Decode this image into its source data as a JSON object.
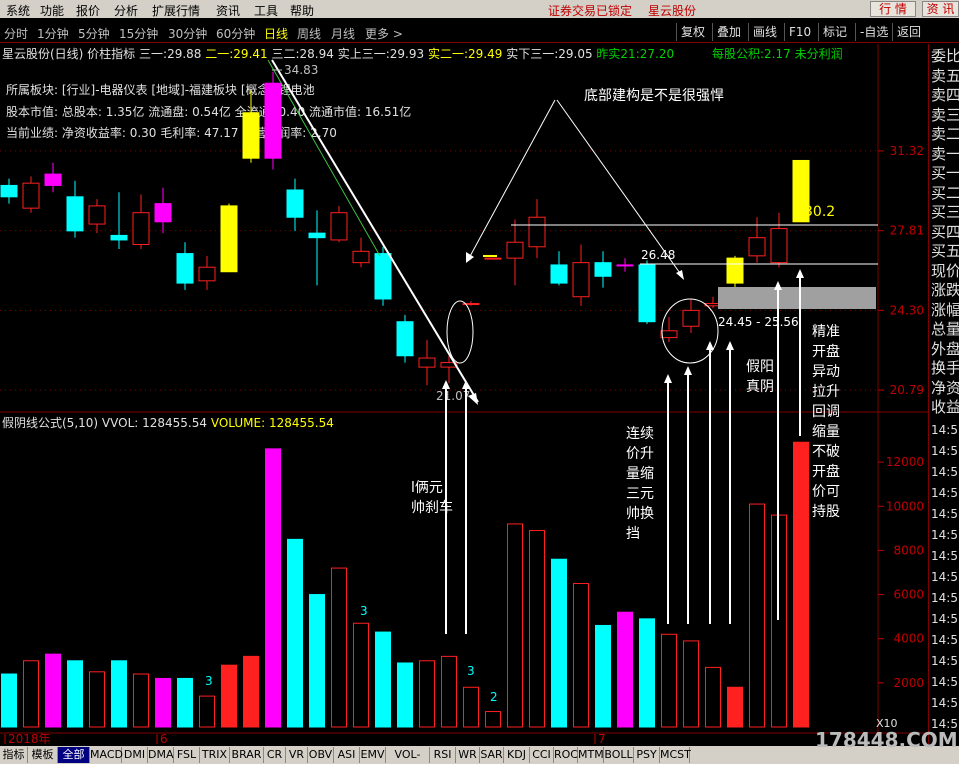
{
  "menu": {
    "items": [
      "系统",
      "功能",
      "报价",
      "分析",
      "扩展行情",
      "资讯",
      "工具",
      "帮助"
    ],
    "lock_status": "证券交易已锁定",
    "stock_name": "星云股份",
    "quote_btn": "行 情",
    "info_btn": "资 讯"
  },
  "periods": {
    "items": [
      "分时",
      "1分钟",
      "5分钟",
      "15分钟",
      "30分钟",
      "60分钟",
      "日线",
      "周线",
      "月线",
      "更多 >"
    ],
    "active_index": 6,
    "tools": [
      "复权",
      "叠加",
      "画线",
      "F10",
      "标记",
      "-自选",
      "返回"
    ]
  },
  "header": {
    "title": "星云股份(日线) 价柱指标",
    "p1_label": "三一:",
    "p1_val": "29.88",
    "p2_label": "二一:",
    "p2_val": "29.41",
    "p3_label": "三二:",
    "p3_val": "28.94",
    "p4_label": "实上三一:",
    "p4_val": "29.93",
    "p5_label": "实二一:",
    "p5_val": "29.49",
    "p6_label": "实下三一:",
    "p6_val": "29.05",
    "p7_label": "昨实21:",
    "p7_val": "27.20",
    "eps_label": "每股公积:",
    "eps_val": "2.17",
    "undist_label": "未分利润"
  },
  "info": {
    "sector": "所属板块: [行业]-电器仪表 [地域]-福建板块 [概念]-锂电池",
    "market_cap": "股本市值: 总股本: 1.35亿 流通盘: 0.54亿 全流通: 0.40 流通市值: 16.51亿",
    "performance": "当前业绩: 净资收益率: 0.30 毛利率: 47.17 主营利润率: 2.70"
  },
  "price_axis": [
    "31.32",
    "27.81",
    "24.30",
    "20.79"
  ],
  "volume_axis": [
    "12000",
    "10000",
    "8000",
    "6000",
    "4000",
    "2000"
  ],
  "volume_header": {
    "formula": "假阴线公式(5,10)",
    "vvol": "VVOL: 128455.54",
    "volume": "VOLUME: 128455.54"
  },
  "x_labels": [
    "2018年",
    "6",
    "7"
  ],
  "volume_scale": "X10",
  "price_labels": {
    "high": "34.83",
    "low": "21.07",
    "mid": "26.48",
    "range": "24.45 - 25.56",
    "target": "30.2"
  },
  "chart_data": {
    "type": "candlestick",
    "ylim": [
      20.0,
      35.5
    ],
    "vol_ylim": [
      0,
      13500
    ],
    "candles": [
      {
        "o": 29.3,
        "c": 29.8,
        "h": 30.1,
        "l": 29.0,
        "v": 2400,
        "color": "cyan"
      },
      {
        "o": 28.8,
        "c": 29.9,
        "h": 30.2,
        "l": 28.6,
        "v": 3000,
        "color": "red"
      },
      {
        "o": 30.3,
        "c": 29.8,
        "h": 30.8,
        "l": 29.5,
        "v": 3300,
        "color": "magenta"
      },
      {
        "o": 29.3,
        "c": 27.8,
        "h": 30.0,
        "l": 27.5,
        "v": 3000,
        "color": "cyan"
      },
      {
        "o": 28.1,
        "c": 28.9,
        "h": 29.2,
        "l": 27.7,
        "v": 2500,
        "color": "red"
      },
      {
        "o": 27.6,
        "c": 27.4,
        "h": 29.5,
        "l": 27.0,
        "v": 3000,
        "color": "cyan"
      },
      {
        "o": 27.2,
        "c": 28.6,
        "h": 29.4,
        "l": 27.0,
        "v": 2400,
        "color": "red"
      },
      {
        "o": 29.0,
        "c": 28.2,
        "h": 29.7,
        "l": 27.7,
        "v": 2200,
        "color": "magenta"
      },
      {
        "o": 26.8,
        "c": 25.5,
        "h": 27.3,
        "l": 25.2,
        "v": 2200,
        "color": "cyan"
      },
      {
        "o": 25.6,
        "c": 26.2,
        "h": 26.7,
        "l": 25.2,
        "v": 1400,
        "color": "red"
      },
      {
        "o": 26.0,
        "c": 28.9,
        "h": 29.0,
        "l": 26.0,
        "v": 2800,
        "color": "yellow"
      },
      {
        "o": 31.0,
        "c": 33.0,
        "h": 34.0,
        "l": 30.8,
        "v": 3200,
        "color": "yellow"
      },
      {
        "o": 31.0,
        "c": 34.3,
        "h": 34.8,
        "l": 30.5,
        "v": 12600,
        "color": "magenta"
      },
      {
        "o": 29.6,
        "c": 28.4,
        "h": 30.1,
        "l": 27.8,
        "v": 8500,
        "color": "cyan"
      },
      {
        "o": 27.7,
        "c": 27.5,
        "h": 28.7,
        "l": 25.4,
        "v": 6000,
        "color": "cyan"
      },
      {
        "o": 27.4,
        "c": 28.6,
        "h": 28.9,
        "l": 27.3,
        "v": 7200,
        "color": "red"
      },
      {
        "o": 26.4,
        "c": 26.9,
        "h": 27.5,
        "l": 26.2,
        "v": 4700,
        "color": "red"
      },
      {
        "o": 26.8,
        "c": 24.8,
        "h": 27.1,
        "l": 24.5,
        "v": 4300,
        "color": "cyan"
      },
      {
        "o": 23.8,
        "c": 22.3,
        "h": 24.1,
        "l": 22.0,
        "v": 2900,
        "color": "cyan"
      },
      {
        "o": 21.8,
        "c": 22.2,
        "h": 23.0,
        "l": 21.0,
        "v": 3000,
        "color": "red"
      },
      {
        "o": 21.8,
        "c": 22.0,
        "h": 22.3,
        "l": 21.1,
        "v": 3200,
        "color": "red"
      },
      {
        "o": 24.6,
        "c": 24.6,
        "h": 24.7,
        "l": 24.5,
        "v": 1800,
        "color": "red"
      },
      {
        "o": 26.6,
        "c": 26.6,
        "h": 26.6,
        "l": 26.6,
        "v": 700,
        "color": "red"
      },
      {
        "o": 26.6,
        "c": 27.3,
        "h": 28.3,
        "l": 25.4,
        "v": 9200,
        "color": "red"
      },
      {
        "o": 27.1,
        "c": 28.4,
        "h": 29.2,
        "l": 26.6,
        "v": 8900,
        "color": "red"
      },
      {
        "o": 26.3,
        "c": 25.5,
        "h": 26.9,
        "l": 25.4,
        "v": 7600,
        "color": "cyan"
      },
      {
        "o": 24.9,
        "c": 26.4,
        "h": 27.2,
        "l": 24.5,
        "v": 6500,
        "color": "red"
      },
      {
        "o": 26.4,
        "c": 25.8,
        "h": 26.9,
        "l": 25.3,
        "v": 4600,
        "color": "cyan"
      },
      {
        "o": 26.3,
        "c": 26.3,
        "h": 26.6,
        "l": 26.0,
        "v": 5200,
        "color": "magenta"
      },
      {
        "o": 26.3,
        "c": 23.8,
        "h": 26.5,
        "l": 23.7,
        "v": 4900,
        "color": "cyan"
      },
      {
        "o": 23.1,
        "c": 23.4,
        "h": 24.0,
        "l": 22.9,
        "v": 4200,
        "color": "red"
      },
      {
        "o": 23.6,
        "c": 24.3,
        "h": 24.8,
        "l": 23.3,
        "v": 3900,
        "color": "red"
      },
      {
        "o": 24.5,
        "c": 24.6,
        "h": 24.9,
        "l": 24.4,
        "v": 2700,
        "color": "red"
      },
      {
        "o": 25.5,
        "c": 26.6,
        "h": 26.7,
        "l": 25.3,
        "v": 1800,
        "color": "yellow"
      },
      {
        "o": 26.7,
        "c": 27.5,
        "h": 28.4,
        "l": 26.4,
        "v": 10100,
        "color": "red"
      },
      {
        "o": 26.4,
        "c": 27.9,
        "h": 28.6,
        "l": 26.2,
        "v": 9600,
        "color": "red"
      },
      {
        "o": 28.2,
        "c": 30.9,
        "h": 30.9,
        "l": 28.2,
        "v": 12900,
        "color": "yellow"
      }
    ]
  },
  "annotations": {
    "weak_bottom": "底部建构是不是很强悍",
    "two_star": "l俩元帅刹车",
    "continuous": "连续价升量缩三元帅换挡",
    "fake_yang": "假阳真阴",
    "precise": "精准开盘异动拉升回调缩量不破开盘价可持股",
    "num_3a": "3",
    "num_3b": "3",
    "num_3c": "3",
    "num_2": "2"
  },
  "rpanel": {
    "labels": [
      "委比",
      "卖五",
      "卖四",
      "卖三",
      "卖二",
      "卖一",
      "买一",
      "买二",
      "买三",
      "买四",
      "买五",
      "现价",
      "涨跌",
      "涨幅",
      "总量",
      "外盘",
      "换手",
      "净资",
      "收益"
    ],
    "times": [
      "14:5",
      "14:5",
      "14:5",
      "14:5",
      "14:5",
      "14:5",
      "14:5",
      "14:5",
      "14:5",
      "14:5",
      "14:5",
      "14:5",
      "14:5",
      "14:5",
      "14:5"
    ]
  },
  "bottom_tabs": [
    "指标",
    "模板",
    "全部",
    "MACD",
    "DMI",
    "DMA",
    "FSL",
    "TRIX",
    "BRAR",
    "CR",
    "VR",
    "OBV",
    "ASI",
    "EMV",
    "VOL-TDX",
    "RSI",
    "WR",
    "SAR",
    "KDJ",
    "CCI",
    "ROC",
    "MTM",
    "BOLL",
    "PSY",
    "MCST"
  ],
  "watermark": "178448.COM"
}
